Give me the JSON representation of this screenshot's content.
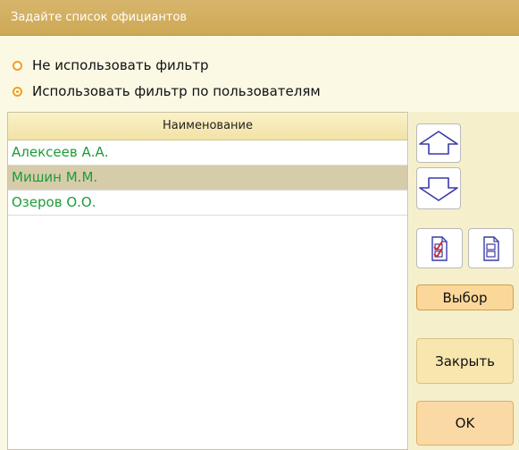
{
  "dialog": {
    "title": "Задайте список официантов"
  },
  "filter_options": [
    {
      "label": "Не использовать фильтр",
      "checked": false
    },
    {
      "label": "Использовать фильтр по пользователям",
      "checked": true
    }
  ],
  "table": {
    "column_header": "Наименование",
    "rows": [
      {
        "name": "Алексеев А.А.",
        "selected": false
      },
      {
        "name": "Мишин М.М.",
        "selected": true
      },
      {
        "name": "Озеров О.О.",
        "selected": false
      }
    ]
  },
  "buttons": {
    "move_up_icon": "arrow-up-icon",
    "move_down_icon": "arrow-down-icon",
    "select_all_icon": "checklist-checked-icon",
    "clear_all_icon": "checklist-unchecked-icon",
    "choose_label": "Выбор",
    "close_label": "Закрыть",
    "ok_label": "OK"
  },
  "colors": {
    "title_bar": "#d2ad5f",
    "radio_accent": "#f0a020",
    "item_text": "#1e9c3a",
    "selected_row": "#d6ccaa",
    "icon_blue": "#3a3aa8",
    "check_red": "#d42020"
  }
}
